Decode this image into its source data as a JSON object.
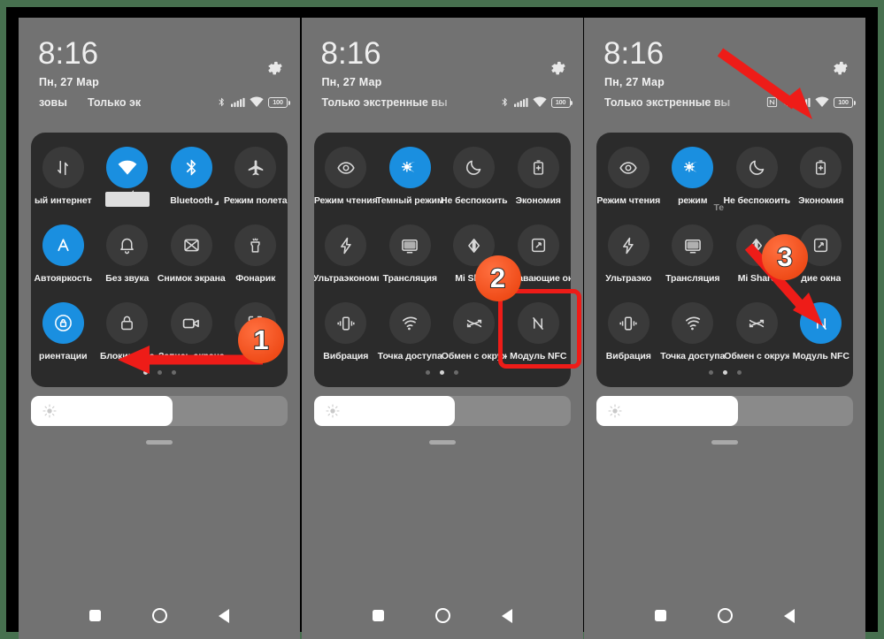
{
  "meta": {
    "frame_color": "#47704f",
    "phone_bg": "#727272",
    "card_bg": "#2b2b2b",
    "accent_on": "#1a8fe0",
    "annotation_red": "#ee1c18",
    "badge_orange": "#ef4b18"
  },
  "status": {
    "time": "8:16",
    "date": "Пн, 27 Мар",
    "carrier_partial": "зовы",
    "carrier_full": "Только экстренные вы",
    "carrier_clipped_p1": "Только эк",
    "battery_level": "100",
    "icons": [
      "nfc-icon",
      "bluetooth-icon",
      "signal-icon",
      "wifi-icon",
      "battery-icon"
    ]
  },
  "panels": [
    {
      "id": "panel-1",
      "page_index": 0,
      "carrier_left": "зовы",
      "carrier_right": "Только эк",
      "nfc_status_icon": false,
      "tiles": [
        {
          "label": "ый интернет",
          "icon": "mobile-data-icon",
          "on": false,
          "caret": false,
          "clip": "left"
        },
        {
          "label": "",
          "icon": "wifi-icon",
          "on": true,
          "caret": true,
          "clip": "none",
          "redacted": true
        },
        {
          "label": "Bluetooth",
          "icon": "bluetooth-icon",
          "on": true,
          "caret": true,
          "clip": "none"
        },
        {
          "label": "Режим полета",
          "icon": "airplane-icon",
          "on": false,
          "caret": false,
          "clip": "none"
        },
        {
          "label": "Автояркость",
          "icon": "auto-brightness-icon",
          "on": true,
          "caret": false,
          "clip": "none"
        },
        {
          "label": "Без звука",
          "icon": "bell-icon",
          "on": false,
          "caret": false,
          "clip": "none"
        },
        {
          "label": "Снимок экрана",
          "icon": "screenshot-icon",
          "on": false,
          "caret": false,
          "clip": "none"
        },
        {
          "label": "Фонарик",
          "icon": "flashlight-icon",
          "on": false,
          "caret": false,
          "clip": "none"
        },
        {
          "label": "риентации",
          "icon": "rotation-lock-icon",
          "on": true,
          "caret": false,
          "clip": "left"
        },
        {
          "label": "Блокировка",
          "icon": "lock-icon",
          "on": false,
          "caret": false,
          "clip": "none"
        },
        {
          "label": "Запись экрана",
          "icon": "screen-record-icon",
          "on": false,
          "caret": false,
          "clip": "none"
        },
        {
          "label": "Ск",
          "icon": "scan-icon",
          "on": false,
          "caret": false,
          "clip": "right"
        }
      ]
    },
    {
      "id": "panel-2",
      "page_index": 1,
      "carrier_left": "",
      "carrier_right": "Только экстренные вы",
      "nfc_status_icon": false,
      "tiles": [
        {
          "label": "Режим чтения",
          "icon": "eye-icon",
          "on": false,
          "caret": false,
          "clip": "none"
        },
        {
          "label": "Темный режим",
          "icon": "dark-mode-icon",
          "on": true,
          "caret": false,
          "clip": "none"
        },
        {
          "label": "Не беспокоить",
          "icon": "moon-icon",
          "on": false,
          "caret": false,
          "clip": "none"
        },
        {
          "label": "Экономия",
          "icon": "battery-saver-icon",
          "on": false,
          "caret": false,
          "clip": "none"
        },
        {
          "label": "Ультраэкономи",
          "icon": "bolt-icon",
          "on": false,
          "caret": false,
          "clip": "right"
        },
        {
          "label": "Трансляция",
          "icon": "cast-icon",
          "on": false,
          "caret": false,
          "clip": "none"
        },
        {
          "label": "Mi Share",
          "icon": "mi-share-icon",
          "on": false,
          "caret": false,
          "clip": "none"
        },
        {
          "label": "Плавающие ок",
          "icon": "floating-window-icon",
          "on": false,
          "caret": false,
          "clip": "right"
        },
        {
          "label": "Вибрация",
          "icon": "vibration-icon",
          "on": false,
          "caret": false,
          "clip": "none"
        },
        {
          "label": "Точка доступа",
          "icon": "hotspot-icon",
          "on": false,
          "caret": false,
          "clip": "none"
        },
        {
          "label": "Обмен с окруж",
          "icon": "nearby-share-icon",
          "on": false,
          "caret": false,
          "clip": "right"
        },
        {
          "label": "Модуль NFC",
          "icon": "nfc-icon",
          "on": false,
          "caret": false,
          "clip": "none"
        }
      ]
    },
    {
      "id": "panel-3",
      "page_index": 1,
      "carrier_left": "",
      "carrier_right": "Только экстренные вы",
      "nfc_status_icon": true,
      "tiles": [
        {
          "label": "Режим чтения",
          "icon": "eye-icon",
          "on": false,
          "caret": false,
          "clip": "none"
        },
        {
          "label": "режим",
          "icon": "dark-mode-icon",
          "on": true,
          "caret": false,
          "clip": "left",
          "ghost_label": "Те"
        },
        {
          "label": "Не беспокоить",
          "icon": "moon-icon",
          "on": false,
          "caret": false,
          "clip": "none"
        },
        {
          "label": "Экономия",
          "icon": "battery-saver-icon",
          "on": false,
          "caret": false,
          "clip": "none"
        },
        {
          "label": "Ультраэко",
          "icon": "bolt-icon",
          "on": false,
          "caret": false,
          "clip": "right"
        },
        {
          "label": "Трансляция",
          "icon": "cast-icon",
          "on": false,
          "caret": false,
          "clip": "none"
        },
        {
          "label": "Mi Share",
          "icon": "mi-share-icon",
          "on": false,
          "caret": false,
          "clip": "none"
        },
        {
          "label": "дие окна",
          "icon": "floating-window-icon",
          "on": false,
          "caret": false,
          "clip": "left"
        },
        {
          "label": "Вибрация",
          "icon": "vibration-icon",
          "on": false,
          "caret": false,
          "clip": "none"
        },
        {
          "label": "Точка доступа",
          "icon": "hotspot-icon",
          "on": false,
          "caret": false,
          "clip": "none"
        },
        {
          "label": "Обмен с окруж",
          "icon": "nearby-share-icon",
          "on": false,
          "caret": false,
          "clip": "right"
        },
        {
          "label": "Модуль NFC",
          "icon": "nfc-icon",
          "on": true,
          "caret": false,
          "clip": "none"
        }
      ]
    }
  ],
  "brightness": {
    "fill_percent": 55,
    "icon": "brightness-icon"
  },
  "navbar": {
    "recents": "recents-square-icon",
    "home": "home-circle-icon",
    "back": "back-triangle-icon"
  },
  "annotations": {
    "badges": [
      {
        "label": "1",
        "panel": 1
      },
      {
        "label": "2",
        "panel": 2
      },
      {
        "label": "3",
        "panel": 3
      }
    ],
    "highlight_box_target": "Модуль NFC",
    "arrows": [
      "arrow-swipe-left",
      "arrow-to-nfc-status",
      "arrow-to-nfc-tile"
    ]
  },
  "page_dots": {
    "count": 3
  }
}
